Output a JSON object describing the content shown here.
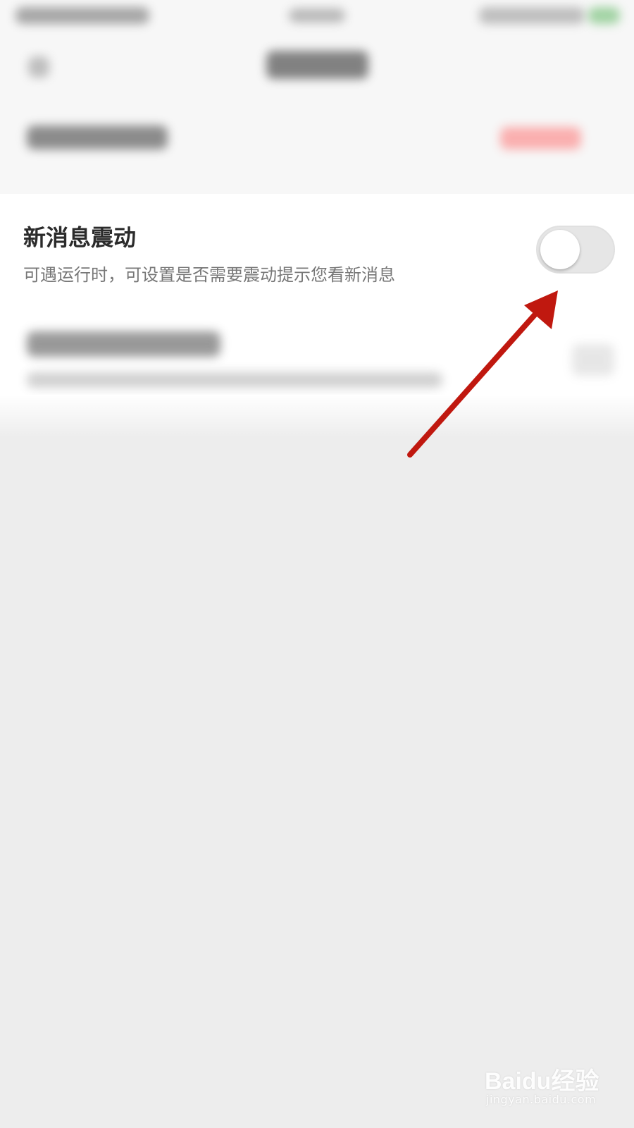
{
  "setting": {
    "title": "新消息震动",
    "description": "可遇运行时，可设置是否需要震动提示您看新消息",
    "toggle_on": false
  },
  "colors": {
    "arrow": "#c0180f",
    "toggle_off": "#e6e6e6",
    "background": "#ededed"
  },
  "watermark": {
    "brand": "Baidu经验",
    "url": "jingyan.baidu.com"
  }
}
